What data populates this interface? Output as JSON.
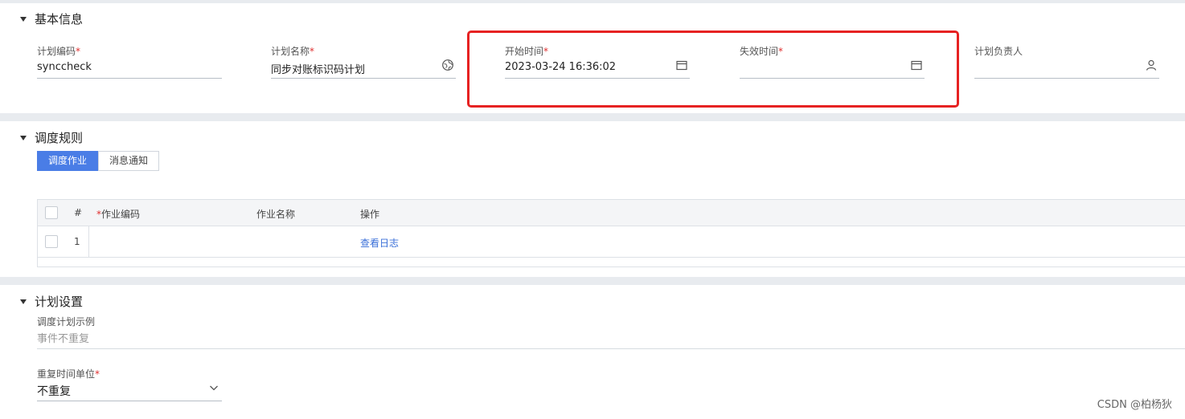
{
  "basic": {
    "title": "基本信息",
    "fields": {
      "plan_code": {
        "label": "计划编码",
        "value": "synccheck"
      },
      "plan_name": {
        "label": "计划名称",
        "value": "同步对账标识码计划"
      },
      "start_time": {
        "label": "开始时间",
        "value": "2023-03-24 16:36:02"
      },
      "expire_time": {
        "label": "失效时间",
        "value": ""
      },
      "owner": {
        "label": "计划负责人",
        "value": ""
      }
    },
    "required_mark": "*"
  },
  "schedule": {
    "title": "调度规则",
    "tabs": [
      {
        "label": "调度作业",
        "active": true
      },
      {
        "label": "消息通知",
        "active": false
      }
    ],
    "table": {
      "columns": [
        "#",
        "作业编码",
        "作业名称",
        "操作"
      ],
      "rows": [
        {
          "index": "1",
          "job_code": "",
          "job_name": "",
          "action": "查看日志"
        }
      ]
    }
  },
  "settings": {
    "title": "计划设置",
    "example_label": "调度计划示例",
    "example_value": "事件不重复",
    "repeat_unit_label": "重复时间单位",
    "repeat_unit_value": "不重复"
  },
  "watermark": "CSDN @柏杨狄",
  "colors": {
    "accent": "#4a7de6",
    "required": "#e03030",
    "highlight": "#e62222",
    "link": "#3a6fd8"
  }
}
